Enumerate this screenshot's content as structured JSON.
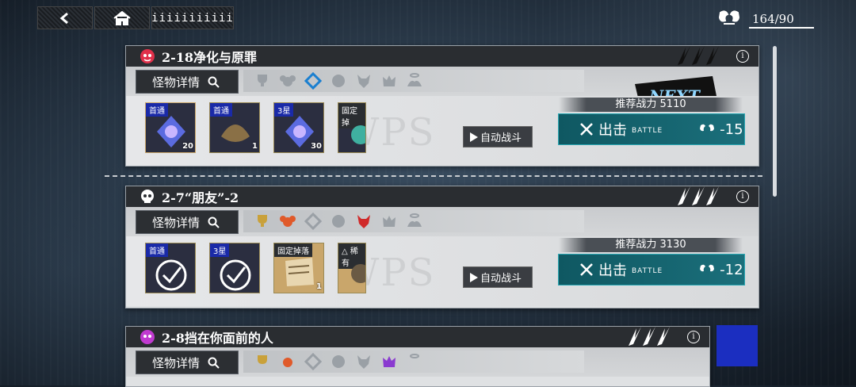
{
  "topbar": {
    "menu_label": "iiiiiiiiiii",
    "resource": {
      "value": "164/90"
    }
  },
  "stages": [
    {
      "title": "2-18净化与原罪",
      "icon": "demon-mask-icon",
      "stars": 0,
      "detail_label": "怪物详情",
      "recommended_power": "推荐战力 5110",
      "auto_label": "自动战斗",
      "battle_label": "出击",
      "battle_sub": "BATTLE",
      "cost": "-15",
      "next_label": "NEXT",
      "drops": [
        {
          "tag": "首通",
          "count": "20"
        },
        {
          "tag": "首通",
          "count": "1"
        },
        {
          "tag": "3星",
          "count": "30"
        },
        {
          "tag": "固定掉",
          "count": ""
        }
      ]
    },
    {
      "title": "2-7“朋友”-2",
      "icon": "skull-icon",
      "stars": 3,
      "detail_label": "怪物详情",
      "recommended_power": "推荐战力 3130",
      "auto_label": "自动战斗",
      "battle_label": "出击",
      "battle_sub": "BATTLE",
      "cost": "-12",
      "drops": [
        {
          "tag": "首通",
          "count": ""
        },
        {
          "tag": "3星",
          "count": ""
        },
        {
          "tag": "固定掉落",
          "count": "1"
        },
        {
          "tag": "△ 稀有",
          "count": ""
        }
      ]
    },
    {
      "title": "2-8挡在你面前的人",
      "icon": "demon-mask-icon",
      "stars": 3,
      "detail_label": "怪物详情"
    }
  ],
  "colors": {
    "battle": "#1b6f7b",
    "accent_blue": "#1b2ec0",
    "header": "#2a2d31"
  }
}
